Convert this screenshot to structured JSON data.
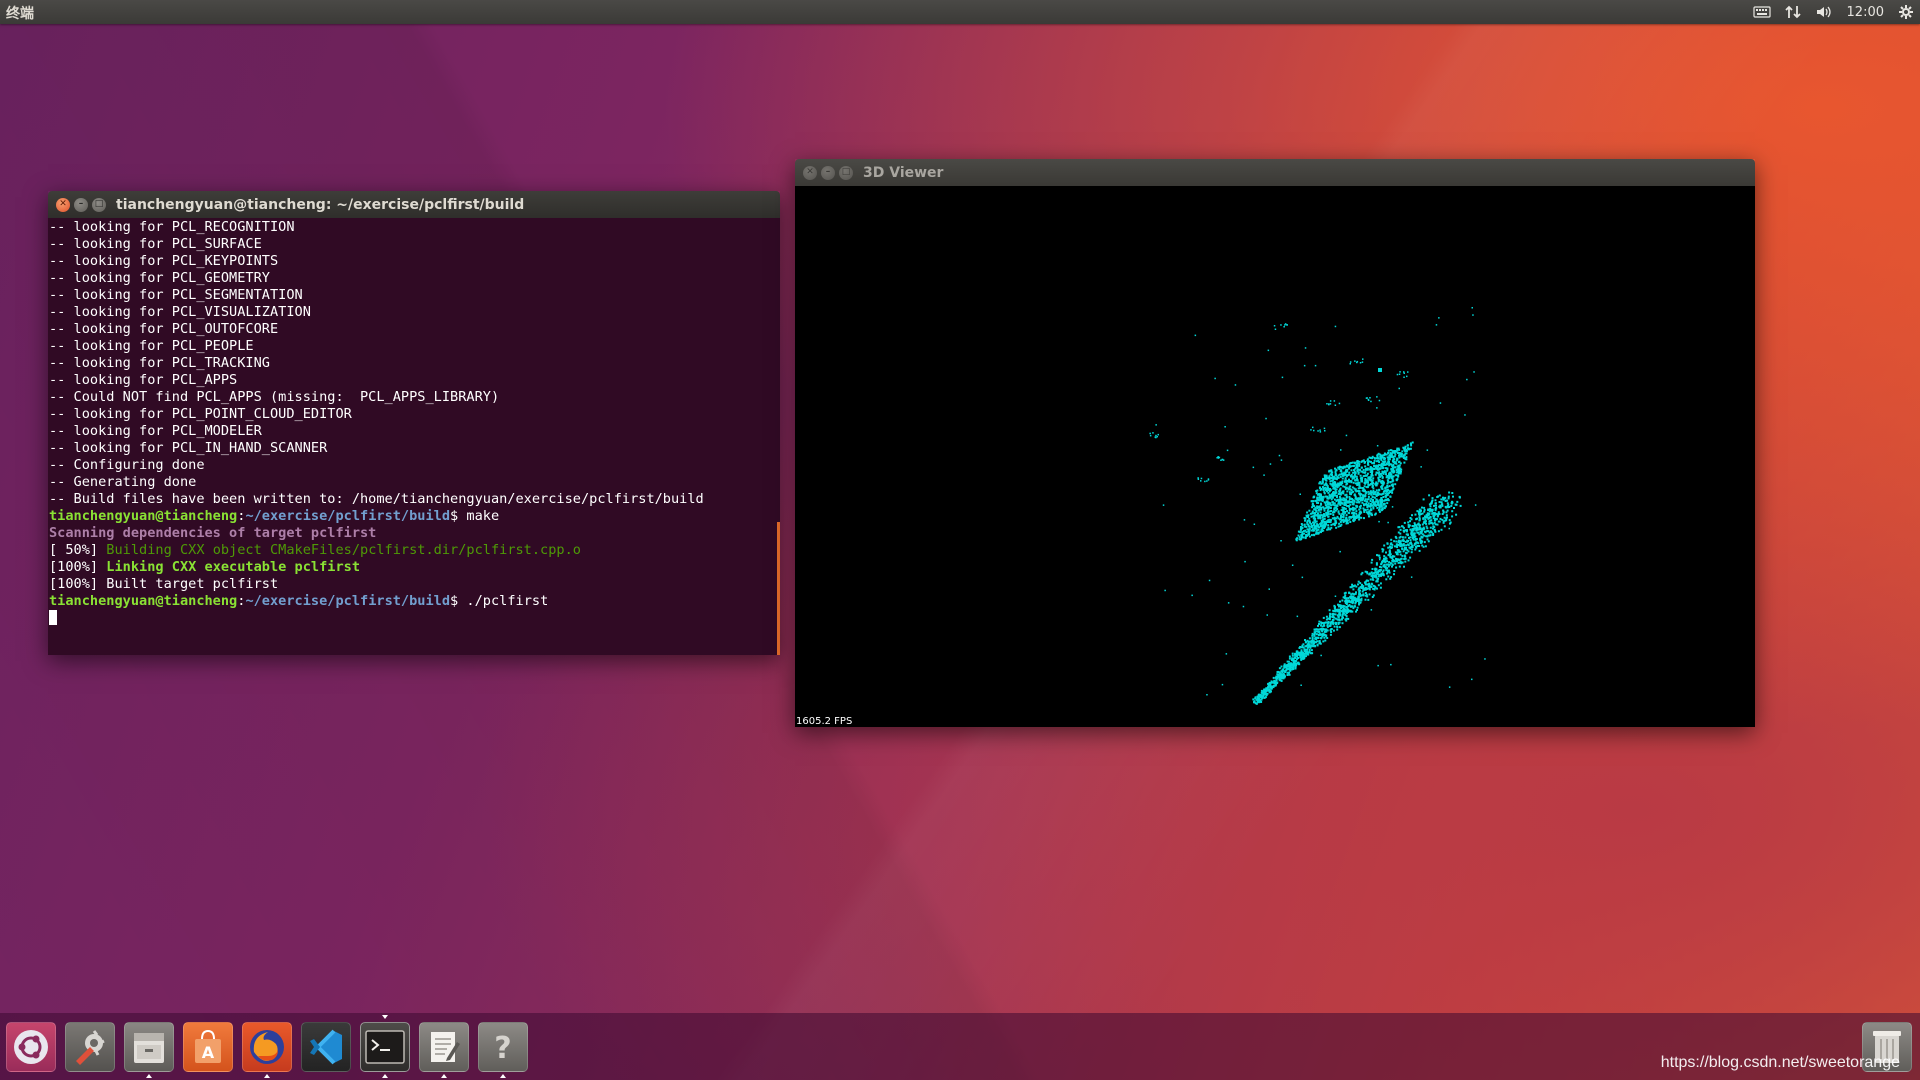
{
  "top_panel": {
    "app_title": "终端",
    "clock": "12:00"
  },
  "terminal": {
    "title": "tianchengyuan@tiancheng: ~/exercise/pclfirst/build",
    "lines": [
      "-- looking for PCL_RECOGNITION",
      "-- looking for PCL_SURFACE",
      "-- looking for PCL_KEYPOINTS",
      "-- looking for PCL_GEOMETRY",
      "-- looking for PCL_SEGMENTATION",
      "-- looking for PCL_VISUALIZATION",
      "-- looking for PCL_OUTOFCORE",
      "-- looking for PCL_PEOPLE",
      "-- looking for PCL_TRACKING",
      "-- looking for PCL_APPS",
      "-- Could NOT find PCL_APPS (missing:  PCL_APPS_LIBRARY)",
      "-- looking for PCL_POINT_CLOUD_EDITOR",
      "-- looking for PCL_MODELER",
      "-- looking for PCL_IN_HAND_SCANNER",
      "-- Configuring done",
      "-- Generating done",
      "-- Build files have been written to: /home/tianchengyuan/exercise/pclfirst/build"
    ],
    "prompt_user": "tianchengyuan@tiancheng",
    "prompt_sep": ":",
    "prompt_path": "~/exercise/pclfirst/build",
    "prompt_dollar": "$ ",
    "cmd_make": "make",
    "scanning": "Scanning dependencies of target pclfirst",
    "build_50_prefix": "[ 50%] ",
    "build_50_text": "Building CXX object CMakeFiles/pclfirst.dir/pclfirst.cpp.o",
    "build_100_prefix": "[100%] ",
    "build_100_text": "Linking CXX executable pclfirst",
    "built_line": "[100%] Built target pclfirst",
    "cmd_run": "./pclfirst"
  },
  "viewer": {
    "title": "3D Viewer",
    "fps": "1605.2 FPS",
    "point_color": "#00d8d8"
  },
  "launcher": {
    "items": [
      {
        "name": "dash-home",
        "icon": "ubuntu-logo-icon"
      },
      {
        "name": "system-settings",
        "icon": "settings-icon"
      },
      {
        "name": "files",
        "icon": "file-cabinet-icon"
      },
      {
        "name": "software-center",
        "icon": "shopping-bag-icon"
      },
      {
        "name": "firefox",
        "icon": "firefox-icon"
      },
      {
        "name": "vscode",
        "icon": "vscode-icon"
      },
      {
        "name": "terminal",
        "icon": "terminal-icon"
      },
      {
        "name": "text-editor",
        "icon": "text-editor-icon"
      },
      {
        "name": "help",
        "icon": "question-mark-icon"
      },
      {
        "name": "trash",
        "icon": "trash-icon"
      }
    ],
    "watermark": "https://blog.csdn.net/sweetorange"
  }
}
